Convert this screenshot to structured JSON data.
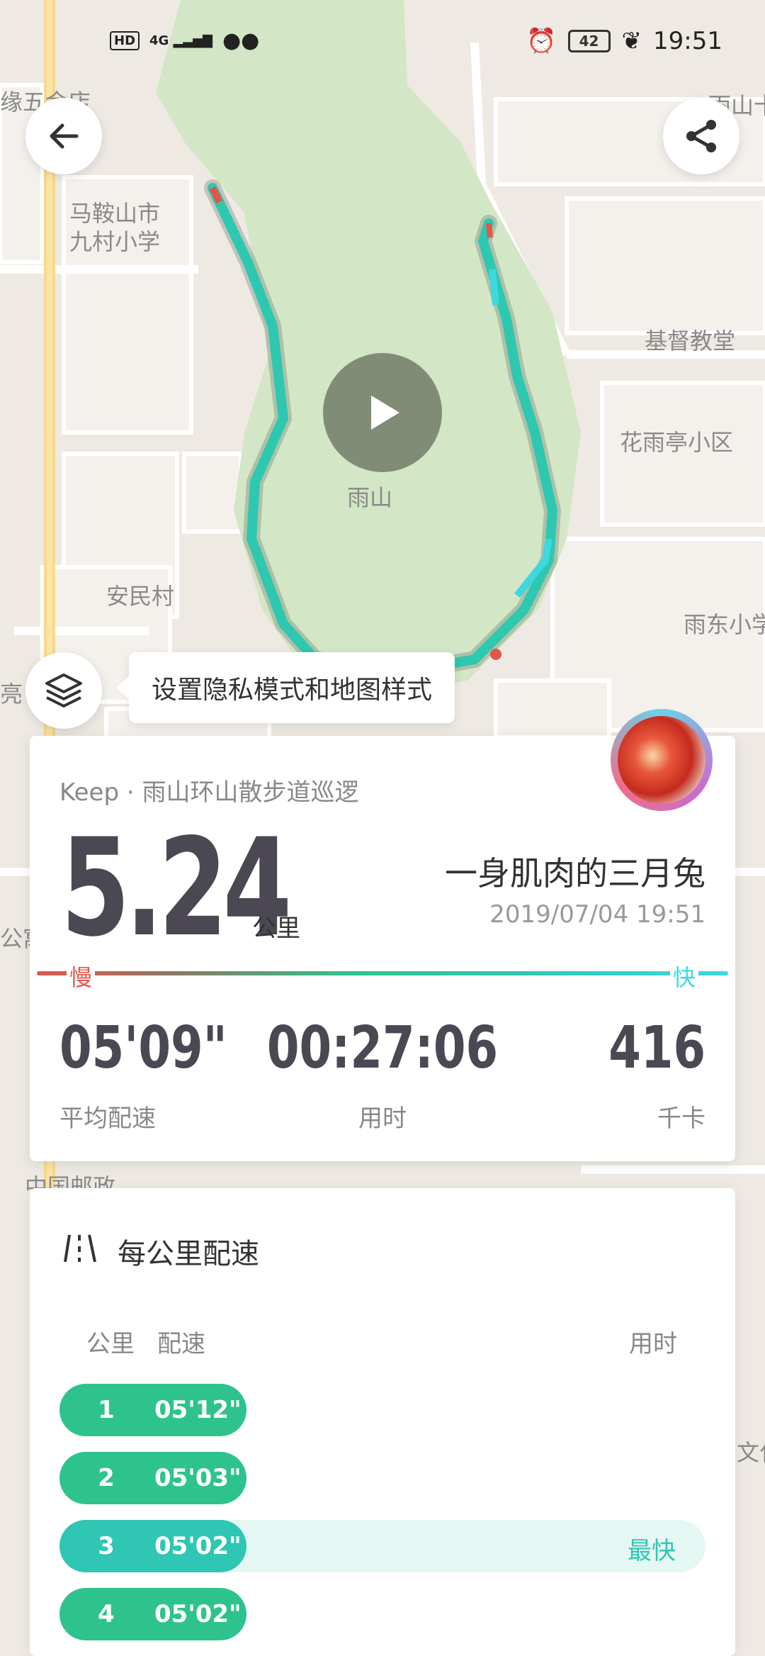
{
  "status_bar": {
    "network": "HD",
    "signal": "4G",
    "battery": "42",
    "time": "19:51"
  },
  "map": {
    "labels": [
      "缘五金店",
      "马鞍山市\n九村小学",
      "基督教堂",
      "花雨亭小区",
      "雨山",
      "安民村",
      "雨东小学",
      "公寓",
      "中国邮政",
      "亮",
      "文化",
      "雨山十"
    ]
  },
  "tip": "设置隐私模式和地图样式",
  "summary": {
    "route": "Keep · 雨山环山散步道巡逻",
    "distance": "5.24",
    "unit": "公里",
    "user": "一身肌肉的三月兔",
    "date": "2019/07/04 19:51",
    "slow_label": "慢",
    "fast_label": "快",
    "stats": [
      {
        "value": "05'09\"",
        "label": "平均配速"
      },
      {
        "value": "00:27:06",
        "label": "用时"
      },
      {
        "value": "416",
        "label": "千卡"
      }
    ]
  },
  "splits": {
    "title": "每公里配速",
    "headers": {
      "km": "公里",
      "pace": "配速",
      "time": "用时"
    },
    "rows": [
      {
        "km": "1",
        "pace": "05'12\""
      },
      {
        "km": "2",
        "pace": "05'03\""
      },
      {
        "km": "3",
        "pace": "05'02\"",
        "tag": "最快"
      },
      {
        "km": "4",
        "pace": "05'02\""
      }
    ]
  },
  "colors": {
    "accent": "#2ec38c",
    "fast": "#3dd8e0",
    "slow": "#e2574c",
    "park": "#d3e6c5"
  }
}
